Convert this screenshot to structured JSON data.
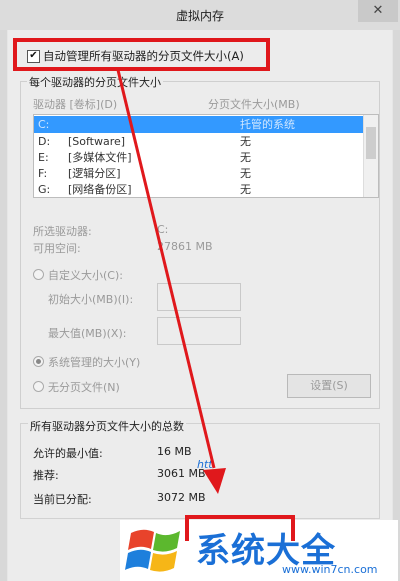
{
  "window": {
    "title": "虚拟内存",
    "close_glyph": "✕"
  },
  "auto_manage": {
    "checked": true,
    "label": "自动管理所有驱动器的分页文件大小(A)"
  },
  "per_drive": {
    "group_label": "每个驱动器的分页文件大小",
    "col_drive": "驱动器 [卷标](D)",
    "col_size": "分页文件大小(MB)",
    "drives": [
      {
        "drive": "C:",
        "label": "",
        "size": "托管的系统",
        "selected": true
      },
      {
        "drive": "D:",
        "label": "[Software]",
        "size": "无",
        "selected": false
      },
      {
        "drive": "E:",
        "label": "[多媒体文件]",
        "size": "无",
        "selected": false
      },
      {
        "drive": "F:",
        "label": "[逻辑分区]",
        "size": "无",
        "selected": false
      },
      {
        "drive": "G:",
        "label": "[网络备份区]",
        "size": "无",
        "selected": false
      }
    ],
    "selected_drive_label": "所选驱动器:",
    "selected_drive_value": "C:",
    "free_space_label": "可用空间:",
    "free_space_value": "27861 MB",
    "custom_size_label": "自定义大小(C):",
    "initial_size_label": "初始大小(MB)(I):",
    "initial_size_value": "",
    "max_size_label": "最大值(MB)(X):",
    "max_size_value": "",
    "system_managed_label": "系统管理的大小(Y)",
    "no_paging_label": "无分页文件(N)",
    "set_button": "设置(S)",
    "selected_option": "system_managed"
  },
  "totals": {
    "group_label": "所有驱动器分页文件大小的总数",
    "min_label": "允许的最小值:",
    "min_value": "16 MB",
    "recommended_label": "推荐:",
    "recommended_value": "3061 MB",
    "current_label": "当前已分配:",
    "current_value": "3072 MB"
  },
  "watermark": {
    "brand": "系统大全",
    "url": "www.win7cn.com",
    "partial_text": "htt"
  },
  "colors": {
    "highlight": "#e0181c",
    "selection": "#3399ff",
    "brand_blue": "#1a6fd6"
  }
}
